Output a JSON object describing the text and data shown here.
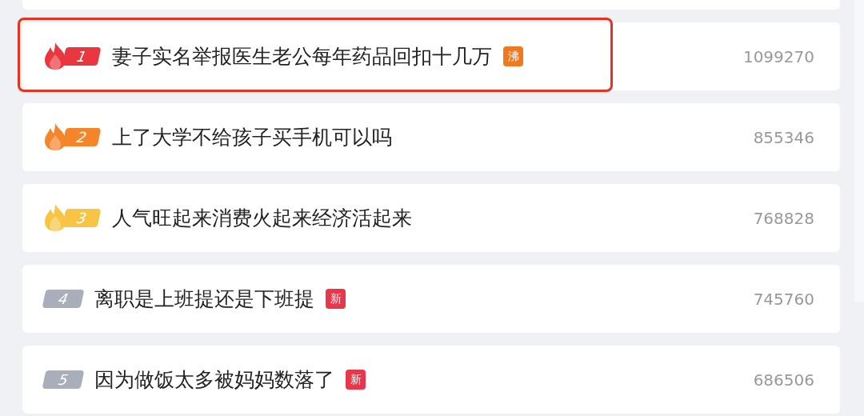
{
  "hot_list": [
    {
      "rank": "1",
      "kind": "hot",
      "color": "#e8373f",
      "title": "妻子实名举报医生老公每年药品回扣十几万",
      "tag": {
        "label": "沸",
        "color": "#f0781e"
      },
      "count": "1099270",
      "highlighted": true
    },
    {
      "rank": "2",
      "kind": "hot",
      "color": "#f5852a",
      "title": "上了大学不给孩子买手机可以吗",
      "count": "855346",
      "highlighted": false
    },
    {
      "rank": "3",
      "kind": "hot",
      "color": "#f8c443",
      "title": "人气旺起来消费火起来经济活起来",
      "count": "768828",
      "highlighted": false
    },
    {
      "rank": "4",
      "kind": "plain",
      "color": "#a9aebb",
      "title": "离职是上班提还是下班提",
      "tag": {
        "label": "新",
        "color": "#e8374a"
      },
      "count": "745760",
      "highlighted": false
    },
    {
      "rank": "5",
      "kind": "plain",
      "color": "#a9aebb",
      "title": "因为做饭太多被妈妈数落了",
      "tag": {
        "label": "新",
        "color": "#e8374a"
      },
      "count": "686506",
      "highlighted": false
    }
  ]
}
